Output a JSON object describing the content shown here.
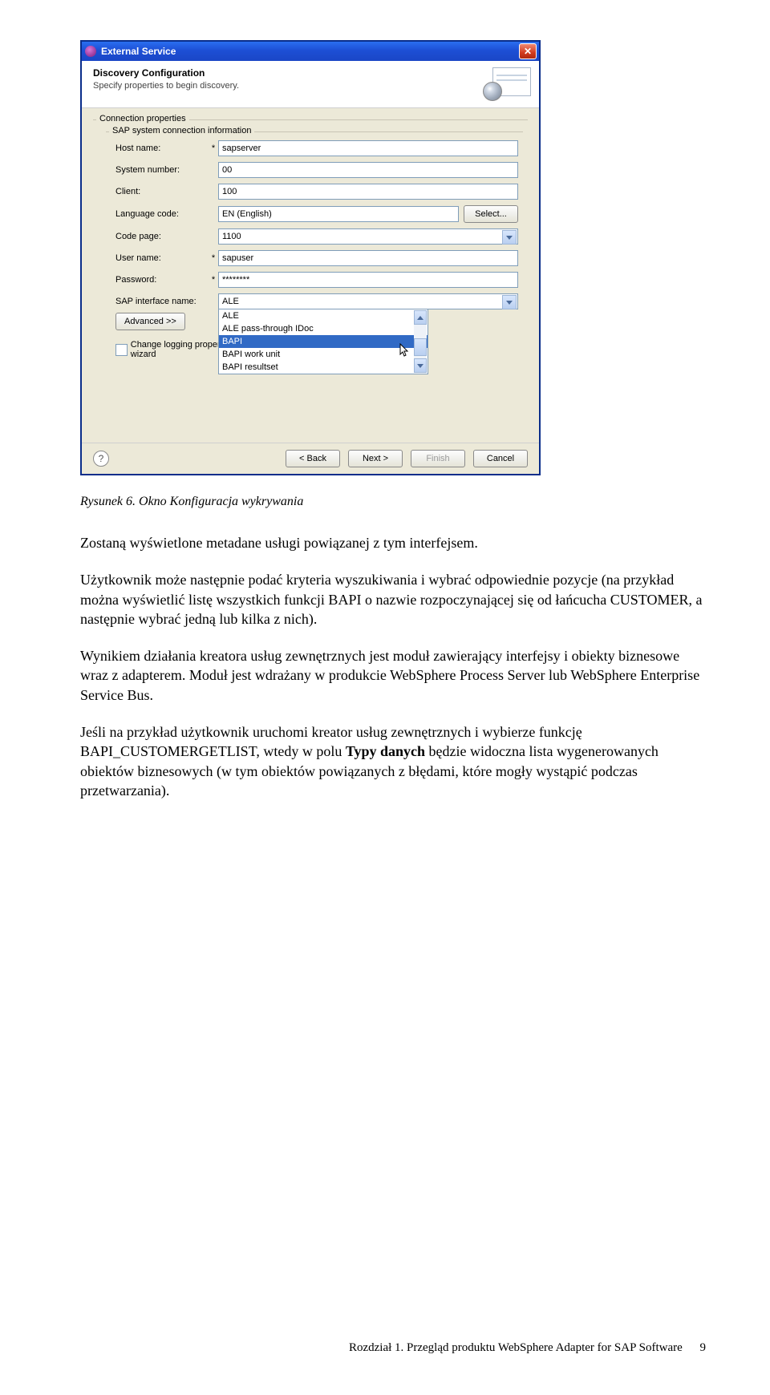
{
  "dialog": {
    "title": "External Service",
    "header_title": "Discovery Configuration",
    "header_sub": "Specify properties to begin discovery.",
    "fieldset_conn": "Connection properties",
    "fieldset_sap": "SAP system connection information",
    "labels": {
      "host": "Host name:",
      "sysnum": "System number:",
      "client": "Client:",
      "lang": "Language code:",
      "codepage": "Code page:",
      "user": "User name:",
      "password": "Password:",
      "iface": "SAP interface name:"
    },
    "req": "*",
    "values": {
      "host": "sapserver",
      "sysnum": "00",
      "client": "100",
      "lang": "EN (English)",
      "codepage": "1100",
      "user": "sapuser",
      "password": "********",
      "iface": "ALE"
    },
    "select_btn": "Select...",
    "advanced_btn": "Advanced >>",
    "change_logging": "Change logging properties for wizard",
    "dropdown_items": [
      "ALE",
      "ALE pass-through IDoc",
      "BAPI",
      "BAPI work unit",
      "BAPI resultset"
    ],
    "footer": {
      "back": "< Back",
      "next": "Next >",
      "finish": "Finish",
      "cancel": "Cancel",
      "help": "?"
    }
  },
  "doc": {
    "fig_caption": "Rysunek 6. Okno Konfiguracja wykrywania",
    "p1": "Zostaną wyświetlone metadane usługi powiązanej z tym interfejsem.",
    "p2": "Użytkownik może następnie podać kryteria wyszukiwania i wybrać odpowiednie pozycje (na przykład można wyświetlić listę wszystkich funkcji BAPI o nazwie rozpoczynającej się od łańcucha CUSTOMER, a następnie wybrać jedną lub kilka z nich).",
    "p3": "Wynikiem działania kreatora usług zewnętrznych jest moduł zawierający interfejsy i obiekty biznesowe wraz z adapterem. Moduł jest wdrażany w produkcie WebSphere Process Server lub WebSphere Enterprise Service Bus.",
    "p4_a": "Jeśli na przykład użytkownik uruchomi kreator usług zewnętrznych i wybierze funkcję BAPI_CUSTOMERGETLIST, wtedy w polu ",
    "p4_b": "Typy danych",
    "p4_c": " będzie widoczna lista wygenerowanych obiektów biznesowych (w tym obiektów powiązanych z błędami, które mogły wystąpić podczas przetwarzania).",
    "footer_text": "Rozdział 1. Przegląd produktu WebSphere Adapter for SAP Software",
    "page_no": "9"
  }
}
